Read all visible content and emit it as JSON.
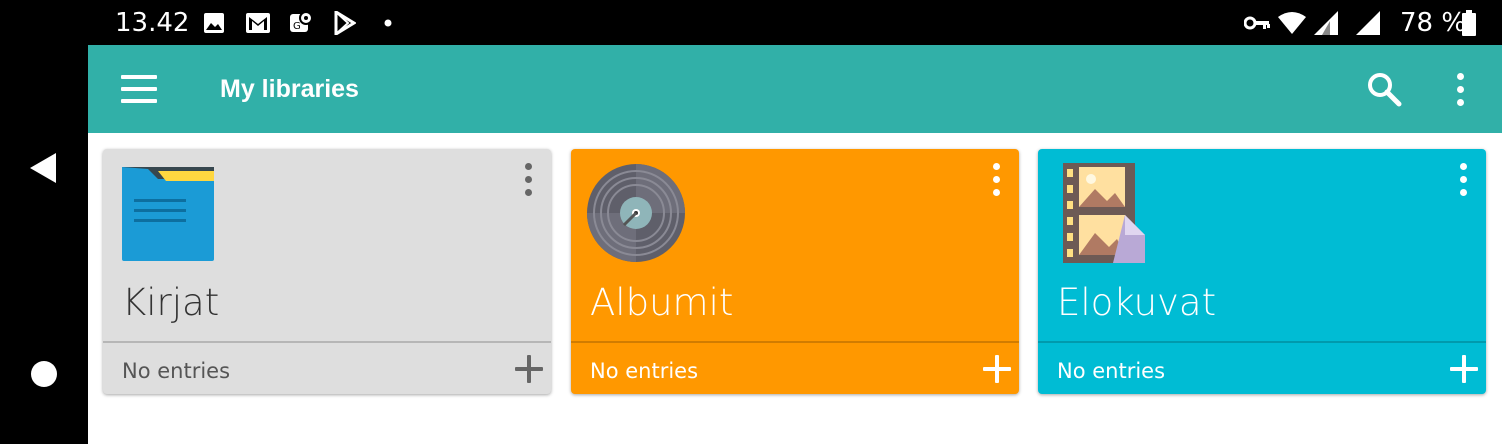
{
  "status_bar": {
    "time": "13.42",
    "battery_text": "78 %",
    "icons": [
      "image-icon",
      "gmail-icon",
      "maps-icon",
      "play-store-icon",
      "dot-icon",
      "vpn-key-icon",
      "wifi-icon",
      "signal-icon",
      "signal-icon",
      "battery-icon"
    ]
  },
  "toolbar": {
    "title": "My libraries",
    "background": "#31b0a8",
    "left_icon": "menu-icon",
    "right_icons": [
      "search-icon",
      "more-vert-icon"
    ]
  },
  "libraries": [
    {
      "name": "Kirjat",
      "status": "No entries",
      "color": "#dedede",
      "text_color": "#333333",
      "icon": "folder-icon"
    },
    {
      "name": "Albumit",
      "status": "No entries",
      "color": "#ff9800",
      "text_color": "#ffffff",
      "icon": "vinyl-record-icon"
    },
    {
      "name": "Elokuvat",
      "status": "No entries",
      "color": "#00bcd4",
      "text_color": "#ffffff",
      "icon": "film-strip-icon"
    }
  ],
  "nav": {
    "icons": [
      "back-icon",
      "home-icon"
    ]
  }
}
